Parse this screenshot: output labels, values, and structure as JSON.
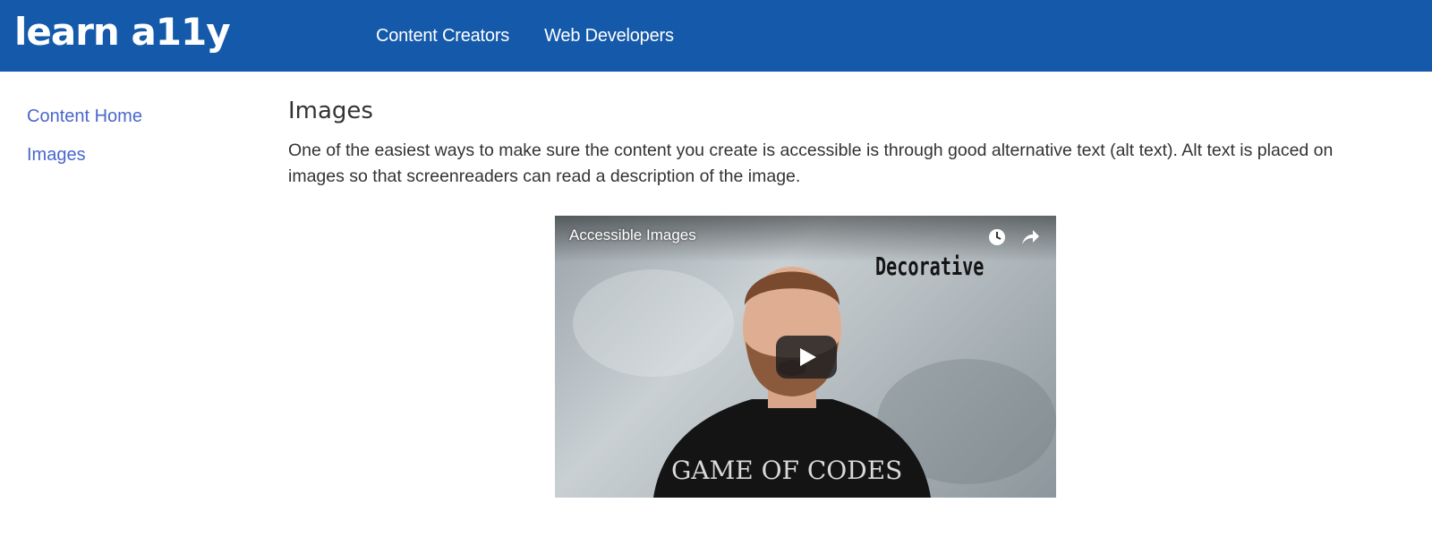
{
  "header": {
    "logo": "learn a11y",
    "nav": [
      "Content Creators",
      "Web Developers"
    ]
  },
  "sidebar": {
    "items": [
      "Content Home",
      "Images"
    ]
  },
  "main": {
    "title": "Images",
    "intro": "One of the easiest ways to make sure the content you create is accessible is through good alternative text (alt text). Alt text is placed on images so that screenreaders can read a description of the image."
  },
  "video": {
    "title": "Accessible Images",
    "overlay_text": "Decorative",
    "shirt_text": "GAME OF CODES",
    "icons": [
      "watch-later-icon",
      "share-icon",
      "play-icon"
    ]
  },
  "colors": {
    "header_bg": "#1459aa",
    "link": "#4a67cc",
    "text": "#333333"
  }
}
